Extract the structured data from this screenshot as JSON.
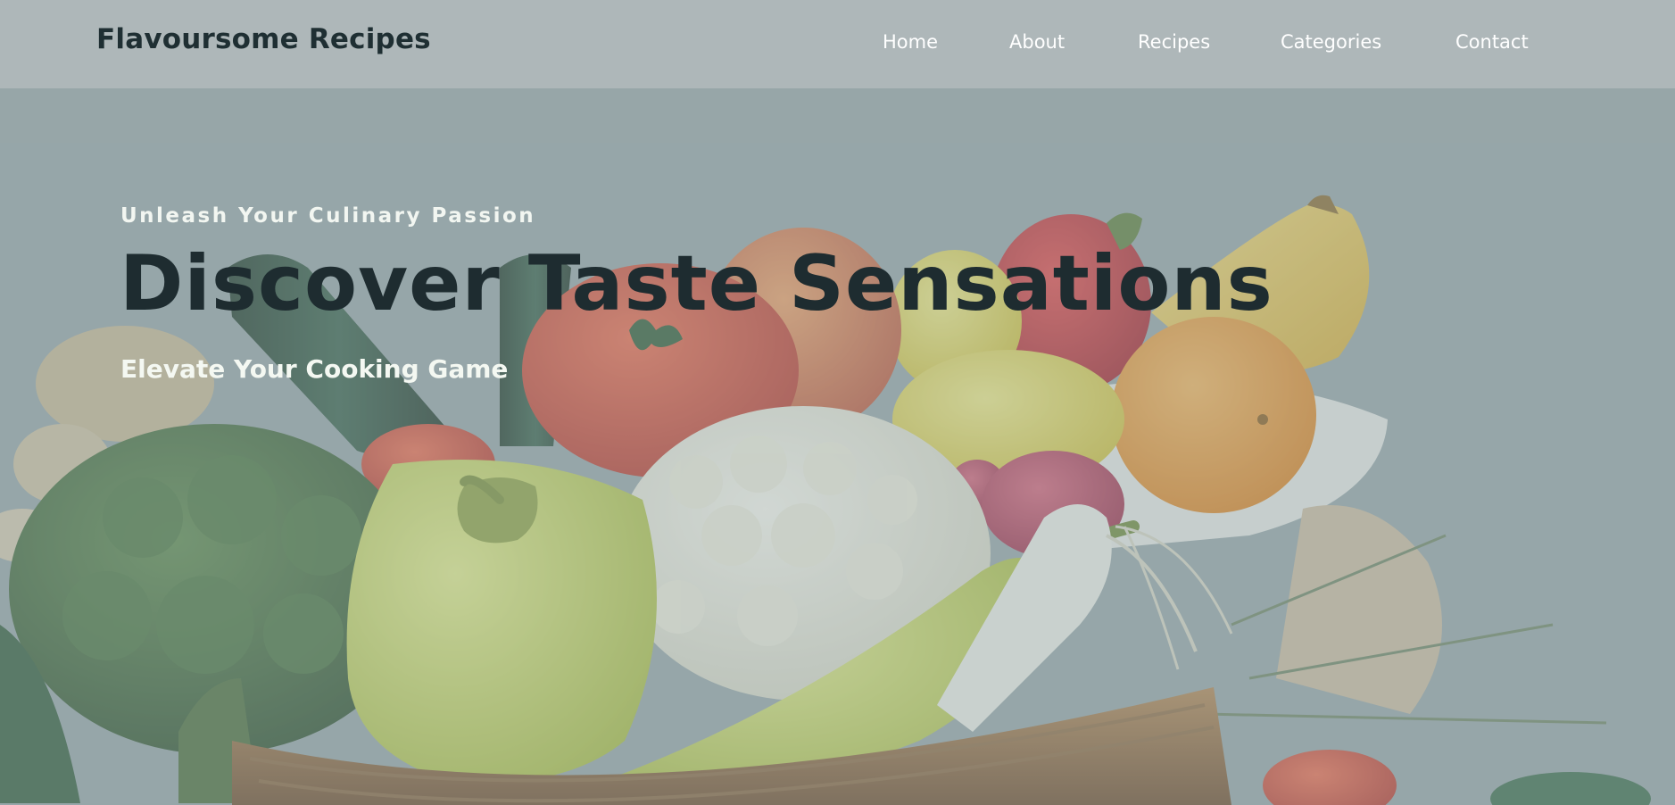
{
  "header": {
    "brand": "Flavoursome Recipes",
    "nav": [
      "Home",
      "About",
      "Recipes",
      "Categories",
      "Contact"
    ]
  },
  "hero": {
    "eyebrow": "Unleash Your Culinary Passion",
    "title": "Discover Taste Sensations",
    "subtitle": "Elevate Your Cooking Game"
  },
  "colors": {
    "overlay": "#97a6a9",
    "navbar": "#b2babb",
    "headline": "#1e2c30",
    "light_text": "#f4f8f2"
  }
}
